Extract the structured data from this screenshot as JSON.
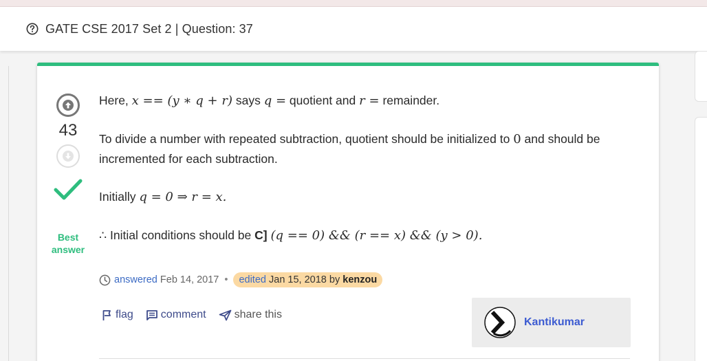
{
  "header": {
    "title": "GATE CSE 2017 Set 2 | Question: 37"
  },
  "vote": {
    "count": "43",
    "best_label_1": "Best",
    "best_label_2": "answer"
  },
  "answer": {
    "p1_a": "Here,",
    "p1_math1": "x == (y ∗ q + r)",
    "p1_b": "says",
    "p1_math2": "q =",
    "p1_c": "quotient and",
    "p1_math3": "r =",
    "p1_d": "remainder.",
    "p2_a": "To divide a number with repeated subtraction, quotient should be initialized to",
    "p2_math": "0",
    "p2_b": "and should be incremented for each subtraction.",
    "p3_a": "Initially",
    "p3_math": "q = 0 ⇒ r = x.",
    "p4_a": "∴ Initial conditions should be",
    "p4_b": "C]",
    "p4_math": "(q == 0) && (r == x) && (y > 0)."
  },
  "meta": {
    "answered": "answered",
    "answered_date": "Feb 14, 2017",
    "bullet": "•",
    "edited": "edited",
    "edited_date": "Jan 15, 2018",
    "by": "by",
    "editor": "kenzou"
  },
  "actions": {
    "flag": "flag",
    "comment": "comment",
    "share": "share this"
  },
  "user": {
    "name": "Kantikumar"
  },
  "colors": {
    "accent": "#2ebd7e",
    "link": "#3c6bc4",
    "edited_bg": "#fbd9a3"
  }
}
